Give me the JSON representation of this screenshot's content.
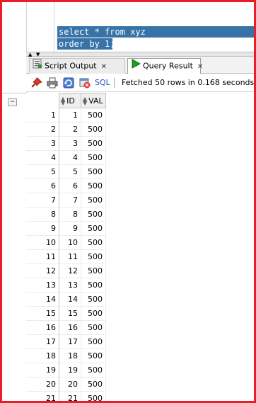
{
  "editor": {
    "lines": [
      "select * from xyz",
      "order by 1;"
    ]
  },
  "tabs": [
    {
      "label": "Script Output",
      "icon": "script-output-icon",
      "active": false
    },
    {
      "label": "Query Result",
      "icon": "run-play-icon",
      "active": true
    }
  ],
  "toolbar": {
    "sql_label": "SQL",
    "status": "Fetched 50 rows in 0.168 seconds",
    "icons": [
      "pin-icon",
      "print-icon",
      "refresh-icon",
      "cancel-icon"
    ]
  },
  "grid": {
    "columns": [
      "ID",
      "VAL"
    ],
    "rows": [
      [
        1,
        1,
        500
      ],
      [
        2,
        2,
        500
      ],
      [
        3,
        3,
        500
      ],
      [
        4,
        4,
        500
      ],
      [
        5,
        5,
        500
      ],
      [
        6,
        6,
        500
      ],
      [
        7,
        7,
        500
      ],
      [
        8,
        8,
        500
      ],
      [
        9,
        9,
        500
      ],
      [
        10,
        10,
        500
      ],
      [
        11,
        11,
        500
      ],
      [
        12,
        12,
        500
      ],
      [
        13,
        13,
        500
      ],
      [
        14,
        14,
        500
      ],
      [
        15,
        15,
        500
      ],
      [
        16,
        16,
        500
      ],
      [
        17,
        17,
        500
      ],
      [
        18,
        18,
        500
      ],
      [
        19,
        19,
        500
      ],
      [
        20,
        20,
        500
      ],
      [
        21,
        21,
        500
      ]
    ]
  },
  "colors": {
    "border": "#ee1c24",
    "selection": "#3873a8",
    "sql_link": "#2a55b8"
  }
}
